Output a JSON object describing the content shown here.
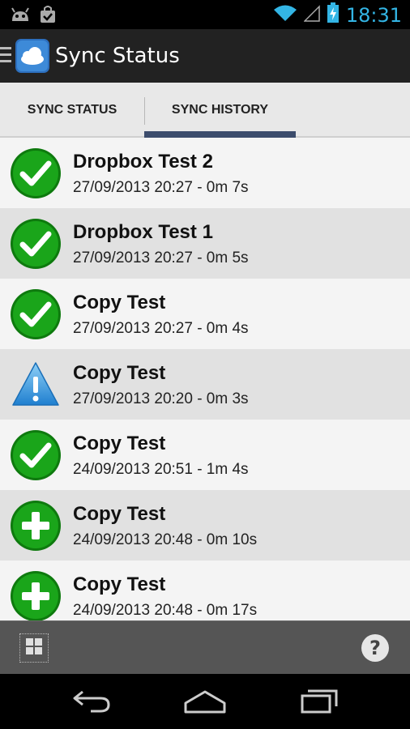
{
  "status_bar": {
    "time": "18:31",
    "icons": [
      "android-icon",
      "shopping-bag-icon",
      "wifi-icon",
      "signal-icon",
      "battery-charging-icon"
    ]
  },
  "action_bar": {
    "title": "Sync Status",
    "icons": [
      "drawer-toggle-icon",
      "cloud-app-icon"
    ]
  },
  "tabs": [
    {
      "label": "SYNC STATUS",
      "selected": false
    },
    {
      "label": "SYNC HISTORY",
      "selected": true
    }
  ],
  "history": [
    {
      "name": "Dropbox Test 2",
      "detail": "27/09/2013 20:27 - 0m 7s",
      "status_icon": "success-check-icon"
    },
    {
      "name": "Dropbox Test 1",
      "detail": "27/09/2013 20:27 - 0m 5s",
      "status_icon": "success-check-icon"
    },
    {
      "name": "Copy Test",
      "detail": "27/09/2013 20:27 - 0m 4s",
      "status_icon": "success-check-icon"
    },
    {
      "name": "Copy Test",
      "detail": "27/09/2013 20:20 - 0m 3s",
      "status_icon": "warning-icon"
    },
    {
      "name": "Copy Test",
      "detail": "24/09/2013 20:51 - 1m 4s",
      "status_icon": "success-check-icon"
    },
    {
      "name": "Copy Test",
      "detail": "24/09/2013 20:48 - 0m 10s",
      "status_icon": "plus-icon"
    },
    {
      "name": "Copy Test",
      "detail": "24/09/2013 20:48 - 0m 17s",
      "status_icon": "plus-icon"
    }
  ],
  "bottom_bar": {
    "help_label": "?",
    "icons": [
      "grid-icon",
      "help-icon"
    ]
  },
  "nav_bar": {
    "icons": [
      "back-icon",
      "home-icon",
      "recents-icon"
    ]
  },
  "colors": {
    "accent": "#33b5e5",
    "tab_indicator": "#3c4c6c",
    "success_green": "#1aa51a",
    "warning_blue": "#2b8fd6"
  }
}
